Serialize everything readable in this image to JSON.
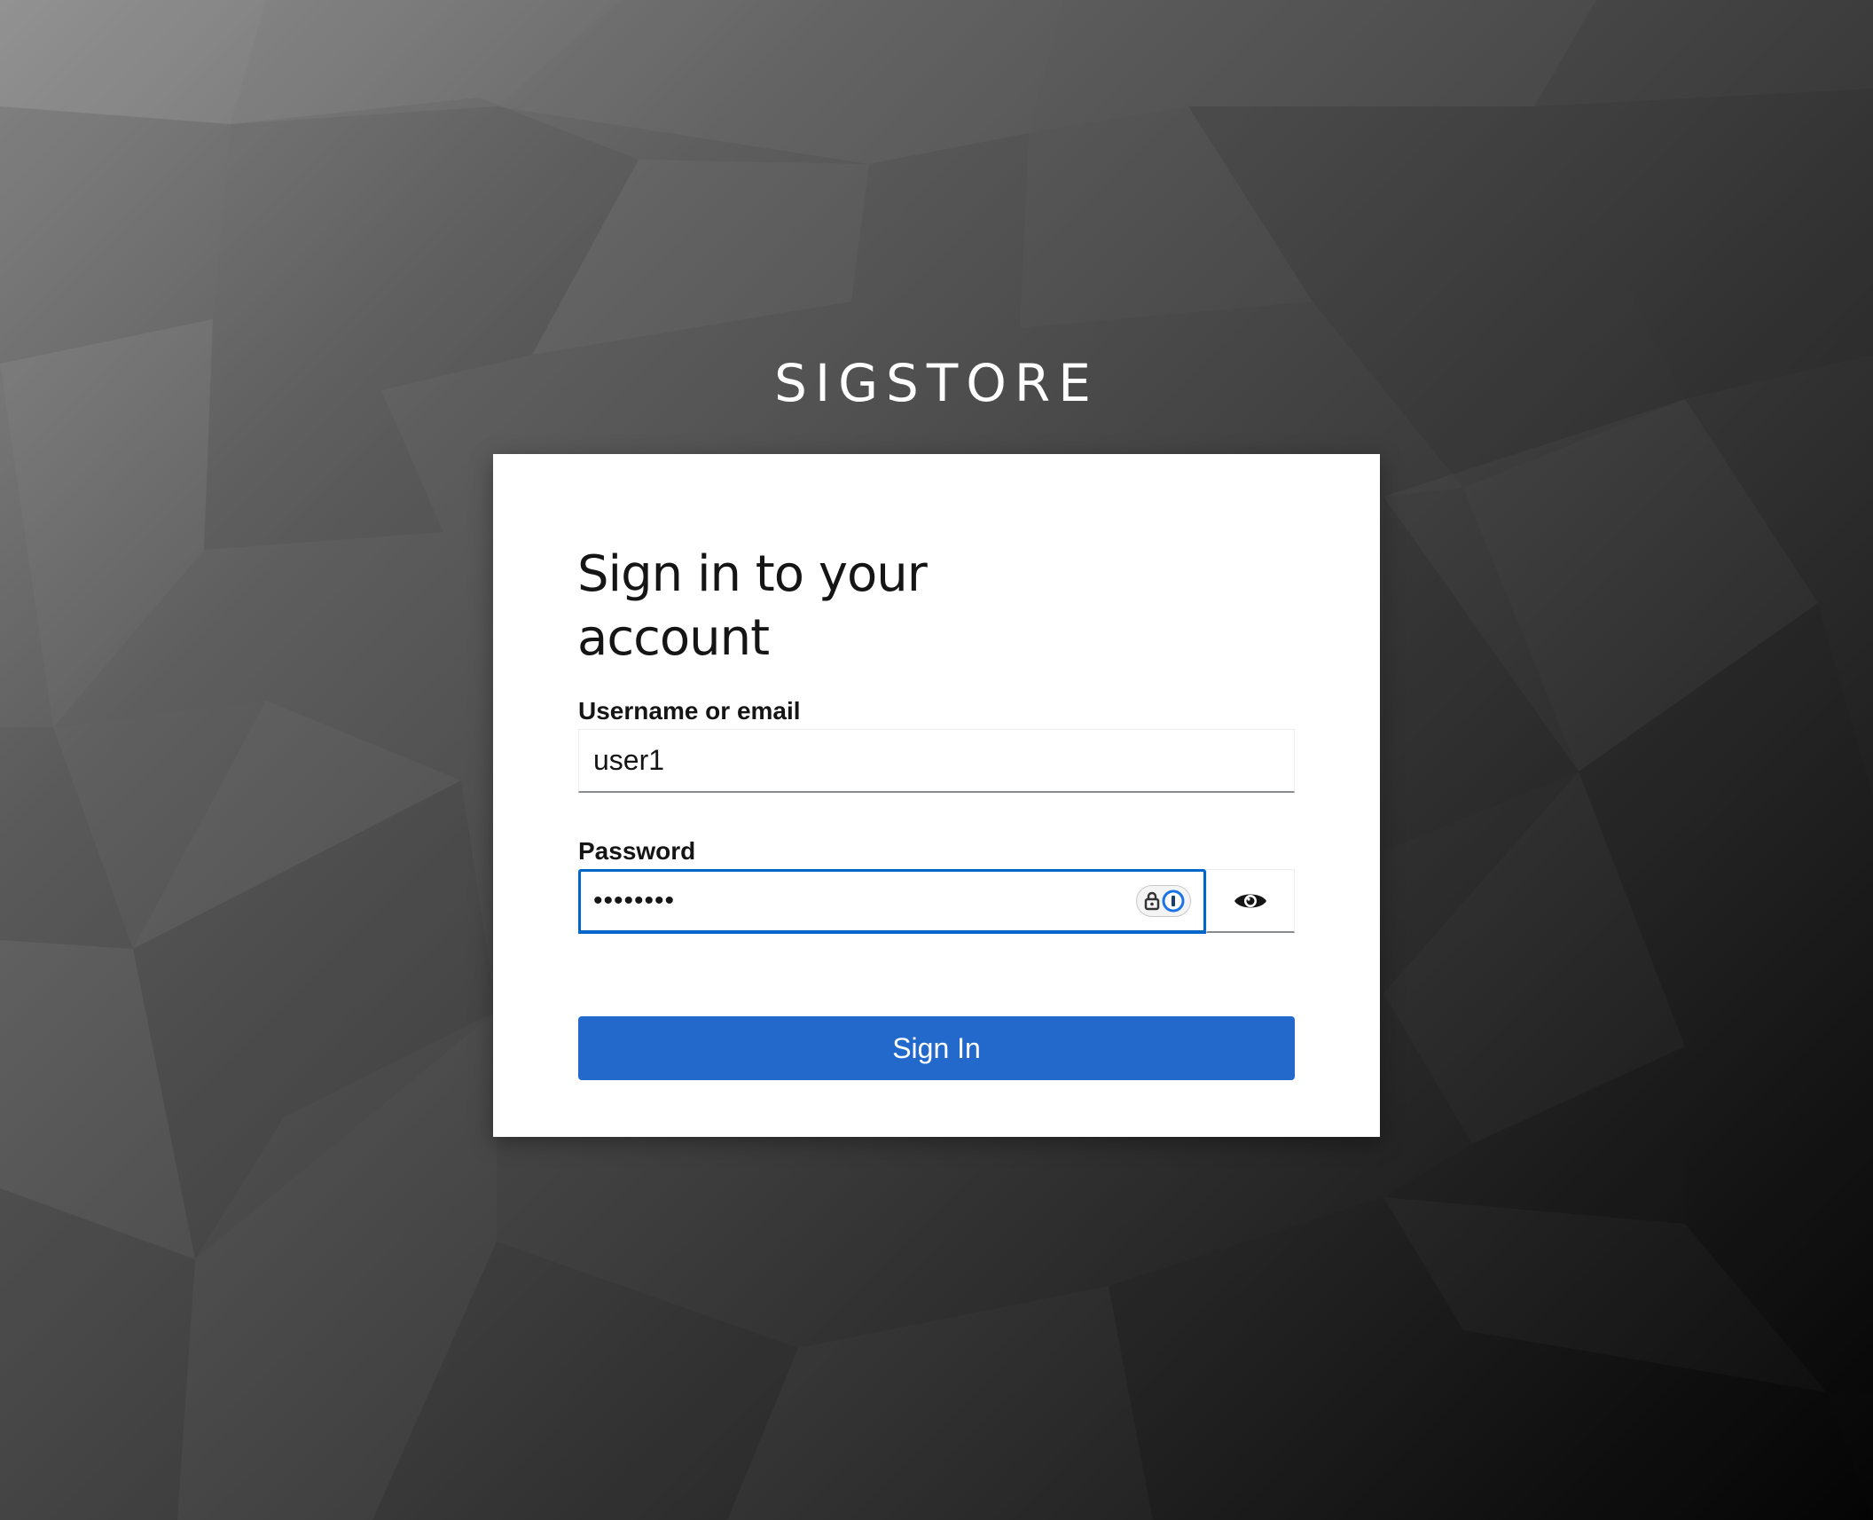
{
  "brand": {
    "name": "SIGSTORE"
  },
  "login": {
    "title": "Sign in to your account",
    "username_label": "Username or email",
    "username_value": "user1",
    "password_label": "Password",
    "password_value": "••••••••",
    "submit_label": "Sign In"
  },
  "icons": {
    "password_manager": "lock-icon",
    "password_manager_brand": "password-manager-icon",
    "show_password": "eye-icon"
  },
  "colors": {
    "primary": "#2369cc",
    "focus": "#0066cc",
    "text": "#151515"
  }
}
